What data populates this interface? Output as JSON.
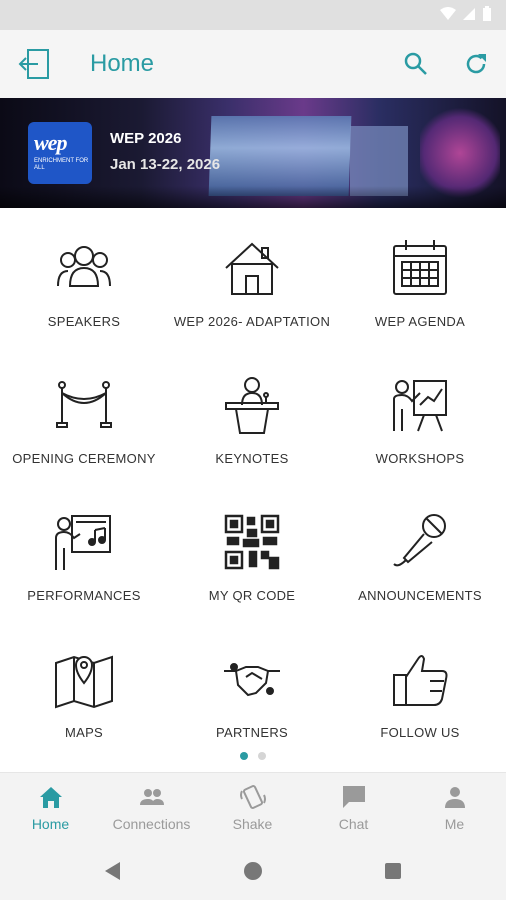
{
  "app": {
    "title": "Home"
  },
  "banner": {
    "event_name": "WEP 2026",
    "event_dates": "Jan 13-22, 2026",
    "logo_text": "wep",
    "logo_sub": "ENRICHMENT FOR ALL"
  },
  "grid": {
    "items": [
      {
        "label": "SPEAKERS",
        "icon": "speakers-icon"
      },
      {
        "label": "WEP 2026- ADAPTATION",
        "icon": "home-icon"
      },
      {
        "label": "WEP AGENDA",
        "icon": "calendar-icon"
      },
      {
        "label": "OPENING CEREMONY",
        "icon": "rope-barrier-icon"
      },
      {
        "label": "KEYNOTES",
        "icon": "podium-icon"
      },
      {
        "label": "WORKSHOPS",
        "icon": "presenter-board-icon"
      },
      {
        "label": "PERFORMANCES",
        "icon": "music-board-icon"
      },
      {
        "label": "MY QR CODE",
        "icon": "qr-code-icon"
      },
      {
        "label": "ANNOUNCEMENTS",
        "icon": "microphone-icon"
      },
      {
        "label": "MAPS",
        "icon": "map-icon"
      },
      {
        "label": "PARTNERS",
        "icon": "handshake-icon"
      },
      {
        "label": "FOLLOW US",
        "icon": "thumbs-up-icon"
      }
    ]
  },
  "pager": {
    "total": 2,
    "active": 1
  },
  "bottom_nav": {
    "items": [
      {
        "label": "Home",
        "icon": "home-icon",
        "active": true
      },
      {
        "label": "Connections",
        "icon": "people-icon",
        "active": false
      },
      {
        "label": "Shake",
        "icon": "shake-phone-icon",
        "active": false
      },
      {
        "label": "Chat",
        "icon": "chat-icon",
        "active": false
      },
      {
        "label": "Me",
        "icon": "person-icon",
        "active": false
      }
    ]
  },
  "colors": {
    "accent": "#2a9ba3",
    "inactive": "#9a9a9a",
    "logo_blue": "#1f56c7"
  }
}
